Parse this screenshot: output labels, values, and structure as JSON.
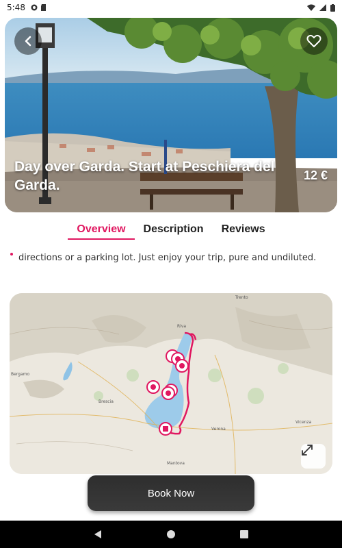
{
  "status_bar": {
    "time": "5:48"
  },
  "hero": {
    "title": "Day over Garda. Start at Peschiera del Garda.",
    "price": "12 €",
    "icons": {
      "back": "arrow-left-icon",
      "favorite": "heart-outline-icon"
    }
  },
  "tabs": [
    {
      "label": "Overview",
      "active": true
    },
    {
      "label": "Description",
      "active": false
    },
    {
      "label": "Reviews",
      "active": false
    }
  ],
  "overview": {
    "text": "directions or a parking lot. Just enjoy your trip, pure and undiluted."
  },
  "map": {
    "labels": [
      "Trento",
      "Riva",
      "Bergamo",
      "Brescia",
      "Verona",
      "Vicenza",
      "Mantova"
    ],
    "expand_icon": "expand-icon",
    "route_color": "#e01760"
  },
  "book_button": {
    "label": "Book Now"
  },
  "colors": {
    "accent": "#e01760",
    "button": "#333333"
  }
}
